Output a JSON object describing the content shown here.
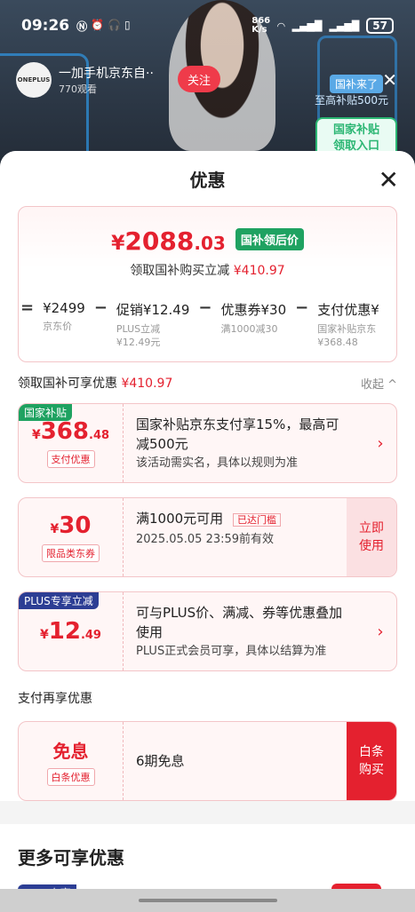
{
  "status": {
    "time": "09:26",
    "speed": "866\nK/s",
    "battery": "57"
  },
  "live": {
    "shop_name": "一加手机京东自··",
    "shop_sub": "770观看",
    "follow": "关注",
    "gov_tag": "国补来了",
    "gov_sub": "至高补贴500元",
    "gov_card": "国家补贴\n领取入口",
    "shop_logo": "ONEPLUS"
  },
  "sheet": {
    "title": "优惠",
    "price": {
      "yen": "¥",
      "int": "2088",
      "dec": ".03",
      "tag": "国补领后价",
      "sub_label": "领取国补购买立减",
      "sub_value": "¥410.97"
    },
    "formula": [
      {
        "op": "=",
        "main": "¥2499",
        "sub": "京东价"
      },
      {
        "op": "−",
        "main": "促销¥12.49",
        "sub": "PLUS立减\n¥12.49元"
      },
      {
        "op": "−",
        "main": "优惠券¥30",
        "sub": "满1000减30"
      },
      {
        "op": "−",
        "main": "支付优惠¥",
        "sub": "国家补贴京东\n¥368.48"
      }
    ],
    "gov_row": {
      "label": "领取国补可享优惠",
      "value": "¥410.97",
      "collapse": "收起 ^"
    },
    "coupons": [
      {
        "tag": "国家补贴",
        "y": "¥",
        "n": "368",
        "d": ".48",
        "pill": "支付优惠",
        "line1": "国家补贴京东支付享15%，最高可减500元",
        "line2": "该活动需实名，具体以规则为准",
        "arrow": "›"
      },
      {
        "y": "¥",
        "n": "30",
        "d": "",
        "pill": "限品类东券",
        "line1": "满1000元可用",
        "reached": "已达门槛",
        "line2": "2025.05.05 23:59前有效",
        "claim": "立即\n使用"
      },
      {
        "tag": "PLUS专享立减",
        "y": "¥",
        "n": "12",
        "d": ".49",
        "pill": "",
        "line1": "可与PLUS价、满减、券等优惠叠加使用",
        "line2": "PLUS正式会员可享，具体以结算为准",
        "arrow": "›"
      }
    ],
    "pay_label": "支付再享优惠",
    "baitiao": {
      "title": "免息",
      "pill": "白条优惠",
      "text": "6期免息",
      "claim": "白条\n购买"
    },
    "more_title": "更多可享优惠",
    "more_tag": "PLUS专享"
  }
}
